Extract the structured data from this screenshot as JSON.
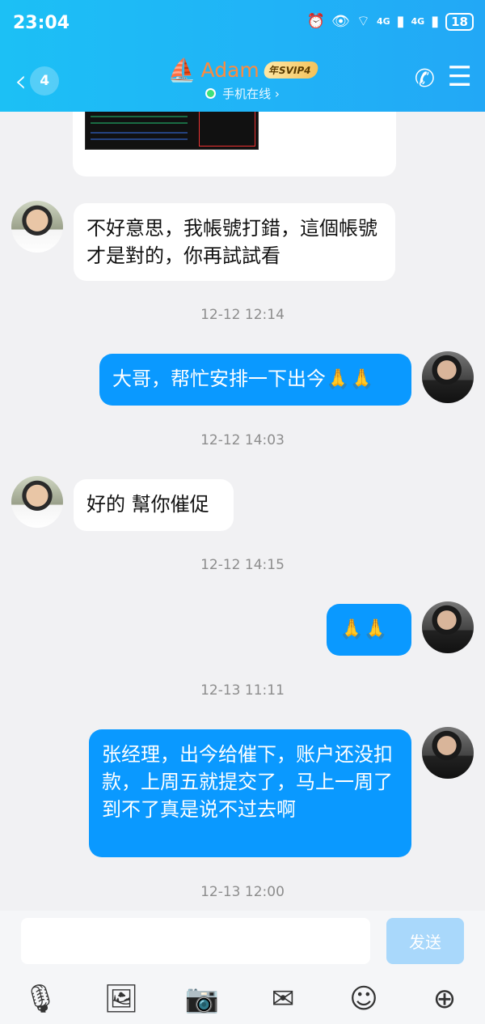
{
  "status_bar": {
    "time": "23:04",
    "network1": "4G",
    "network2": "4G",
    "battery": "18"
  },
  "header": {
    "unread_count": "4",
    "contact_name": "Adam",
    "vip_badge": "年SVIP4",
    "online_status": "手机在线 ›"
  },
  "messages": [
    {
      "side": "in",
      "text": "不好意思，我帳號打錯，這個帳號才是對的，你再試試看"
    },
    {
      "time": "12-12 12:14"
    },
    {
      "side": "out",
      "text": "大哥，帮忙安排一下出今🙏🙏"
    },
    {
      "time": "12-12 14:03"
    },
    {
      "side": "in",
      "text": "好的 幫你催促"
    },
    {
      "time": "12-12 14:15"
    },
    {
      "side": "out",
      "text": "🙏🙏"
    },
    {
      "time": "12-13 11:11"
    },
    {
      "side": "out",
      "text": "张经理，出今给催下，账户还没扣款，上周五就提交了，马上一周了到不了真是说不过去啊"
    },
    {
      "time": "12-13 12:00"
    }
  ],
  "composer": {
    "send_label": "发送",
    "placeholder": ""
  },
  "toolbar_icons": [
    "microphone-icon",
    "image-icon",
    "camera-icon",
    "red-packet-icon",
    "emoji-icon",
    "plus-icon"
  ]
}
